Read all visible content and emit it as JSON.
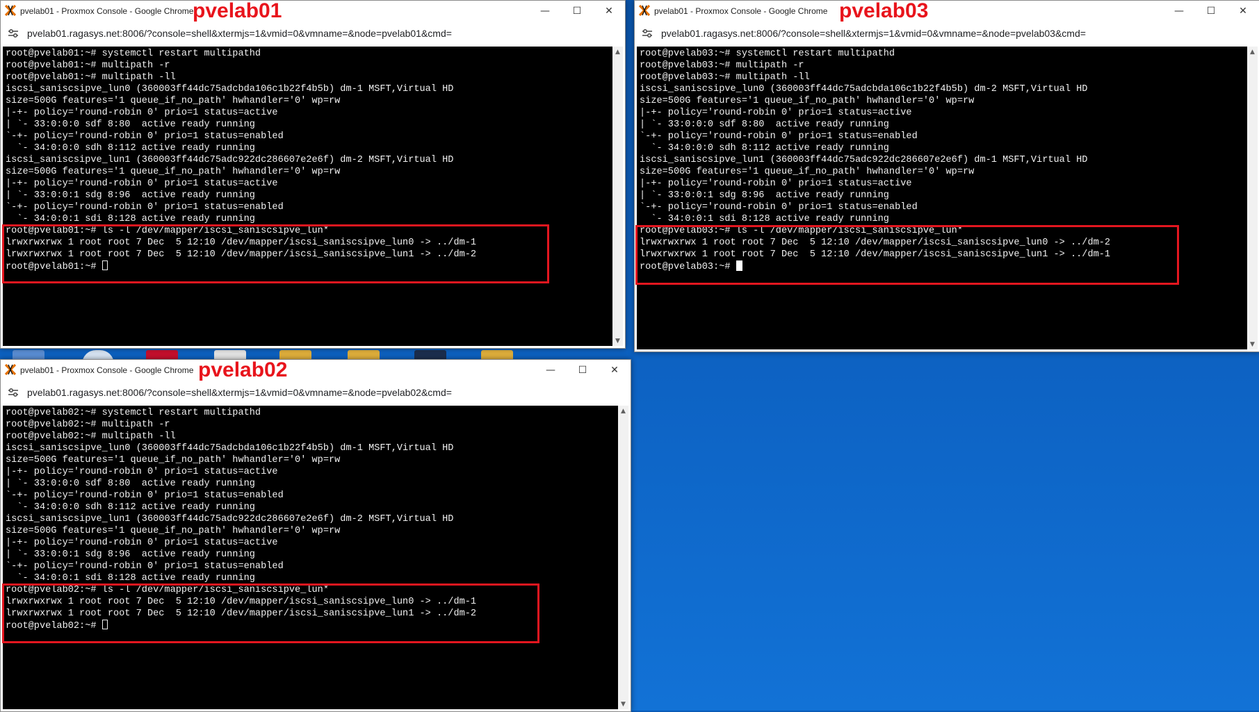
{
  "desktop": {
    "background_color": "#0b56ad"
  },
  "windows": {
    "pvelab01": {
      "title": "pvelab01 - Proxmox Console - Google Chrome",
      "label": "pvelab01",
      "url": "pvelab01.ragasys.net:8006/?console=shell&xtermjs=1&vmid=0&vmname=&node=pvelab01&cmd=",
      "lines": [
        "root@pvelab01:~# systemctl restart multipathd",
        "root@pvelab01:~# multipath -r",
        "root@pvelab01:~# multipath -ll",
        "iscsi_saniscsipve_lun0 (360003ff44dc75adcbda106c1b22f4b5b) dm-1 MSFT,Virtual HD",
        "size=500G features='1 queue_if_no_path' hwhandler='0' wp=rw",
        "|-+- policy='round-robin 0' prio=1 status=active",
        "| `- 33:0:0:0 sdf 8:80  active ready running",
        "`-+- policy='round-robin 0' prio=1 status=enabled",
        "  `- 34:0:0:0 sdh 8:112 active ready running",
        "iscsi_saniscsipve_lun1 (360003ff44dc75adc922dc286607e2e6f) dm-2 MSFT,Virtual HD",
        "size=500G features='1 queue_if_no_path' hwhandler='0' wp=rw",
        "|-+- policy='round-robin 0' prio=1 status=active",
        "| `- 33:0:0:1 sdg 8:96  active ready running",
        "`-+- policy='round-robin 0' prio=1 status=enabled",
        "  `- 34:0:0:1 sdi 8:128 active ready running",
        "root@pvelab01:~# ls -l /dev/mapper/iscsi_saniscsipve_lun*",
        "lrwxrwxrwx 1 root root 7 Dec  5 12:10 /dev/mapper/iscsi_saniscsipve_lun0 -> ../dm-1",
        "lrwxrwxrwx 1 root root 7 Dec  5 12:10 /dev/mapper/iscsi_saniscsipve_lun1 -> ../dm-2",
        "root@pvelab01:~# "
      ]
    },
    "pvelab02": {
      "title": "pvelab01 - Proxmox Console - Google Chrome",
      "label": "pvelab02",
      "url": "pvelab01.ragasys.net:8006/?console=shell&xtermjs=1&vmid=0&vmname=&node=pvelab02&cmd=",
      "lines": [
        "root@pvelab02:~# systemctl restart multipathd",
        "root@pvelab02:~# multipath -r",
        "root@pvelab02:~# multipath -ll",
        "iscsi_saniscsipve_lun0 (360003ff44dc75adcbda106c1b22f4b5b) dm-1 MSFT,Virtual HD",
        "size=500G features='1 queue_if_no_path' hwhandler='0' wp=rw",
        "|-+- policy='round-robin 0' prio=1 status=active",
        "| `- 33:0:0:0 sdf 8:80  active ready running",
        "`-+- policy='round-robin 0' prio=1 status=enabled",
        "  `- 34:0:0:0 sdh 8:112 active ready running",
        "iscsi_saniscsipve_lun1 (360003ff44dc75adc922dc286607e2e6f) dm-2 MSFT,Virtual HD",
        "size=500G features='1 queue_if_no_path' hwhandler='0' wp=rw",
        "|-+- policy='round-robin 0' prio=1 status=active",
        "| `- 33:0:0:1 sdg 8:96  active ready running",
        "`-+- policy='round-robin 0' prio=1 status=enabled",
        "  `- 34:0:0:1 sdi 8:128 active ready running",
        "root@pvelab02:~# ls -l /dev/mapper/iscsi_saniscsipve_lun*",
        "lrwxrwxrwx 1 root root 7 Dec  5 12:10 /dev/mapper/iscsi_saniscsipve_lun0 -> ../dm-1",
        "lrwxrwxrwx 1 root root 7 Dec  5 12:10 /dev/mapper/iscsi_saniscsipve_lun1 -> ../dm-2",
        "root@pvelab02:~# "
      ]
    },
    "pvelab03": {
      "title": "pvelab01 - Proxmox Console - Google Chrome",
      "label": "pvelab03",
      "url": "pvelab01.ragasys.net:8006/?console=shell&xtermjs=1&vmid=0&vmname=&node=pvelab03&cmd=",
      "lines": [
        "root@pvelab03:~# systemctl restart multipathd",
        "root@pvelab03:~# multipath -r",
        "root@pvelab03:~# multipath -ll",
        "iscsi_saniscsipve_lun0 (360003ff44dc75adcbda106c1b22f4b5b) dm-2 MSFT,Virtual HD",
        "size=500G features='1 queue_if_no_path' hwhandler='0' wp=rw",
        "|-+- policy='round-robin 0' prio=1 status=active",
        "| `- 33:0:0:0 sdf 8:80  active ready running",
        "`-+- policy='round-robin 0' prio=1 status=enabled",
        "  `- 34:0:0:0 sdh 8:112 active ready running",
        "iscsi_saniscsipve_lun1 (360003ff44dc75adc922dc286607e2e6f) dm-1 MSFT,Virtual HD",
        "size=500G features='1 queue_if_no_path' hwhandler='0' wp=rw",
        "|-+- policy='round-robin 0' prio=1 status=active",
        "| `- 33:0:0:1 sdg 8:96  active ready running",
        "`-+- policy='round-robin 0' prio=1 status=enabled",
        "  `- 34:0:0:1 sdi 8:128 active ready running",
        "root@pvelab03:~# ls -l /dev/mapper/iscsi_saniscsipve_lun*",
        "lrwxrwxrwx 1 root root 7 Dec  5 12:10 /dev/mapper/iscsi_saniscsipve_lun0 -> ../dm-2",
        "lrwxrwxrwx 1 root root 7 Dec  5 12:10 /dev/mapper/iscsi_saniscsipve_lun1 -> ../dm-1",
        "root@pvelab03:~# "
      ]
    }
  },
  "controls": {
    "minimize": "—",
    "maximize": "☐",
    "close": "✕"
  },
  "colors": {
    "annotation_red": "#e3161f",
    "terminal_bg": "#000000",
    "terminal_fg": "#f0f0f0"
  }
}
